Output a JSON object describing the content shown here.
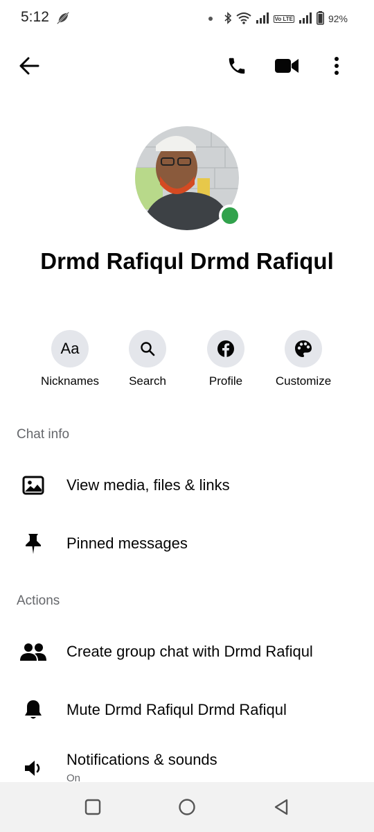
{
  "status": {
    "time": "5:12",
    "battery": "92%",
    "volte": "Vo LTE"
  },
  "profile": {
    "name": "Drmd Rafiqul Drmd Rafiqul",
    "online_color": "#31a24c"
  },
  "quick_actions": [
    {
      "label": "Nicknames",
      "glyph": "Aa"
    },
    {
      "label": "Search"
    },
    {
      "label": "Profile"
    },
    {
      "label": "Customize"
    }
  ],
  "sections": {
    "chat_info": {
      "title": "Chat info",
      "items": [
        {
          "label": "View media, files & links",
          "icon": "image-icon"
        },
        {
          "label": "Pinned messages",
          "icon": "pin-icon"
        }
      ]
    },
    "actions": {
      "title": "Actions",
      "items": [
        {
          "label": "Create group chat with Drmd Rafiqul",
          "icon": "people-icon"
        },
        {
          "label": "Mute Drmd Rafiqul Drmd Rafiqul",
          "icon": "bell-icon"
        },
        {
          "label": "Notifications & sounds",
          "sub": "On",
          "icon": "speaker-icon"
        }
      ]
    }
  }
}
